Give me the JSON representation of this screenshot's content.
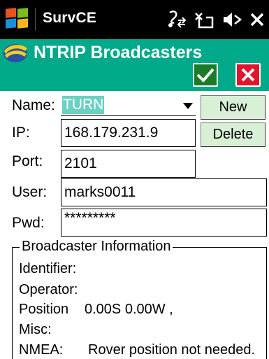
{
  "status_bar": {
    "app_name": "SurvCE",
    "icons": [
      "windows-start-icon",
      "connectivity-icon",
      "signal-off-icon",
      "volume-icon",
      "close-icon"
    ]
  },
  "title_bar": {
    "title": "NTRIP Broadcasters",
    "logo": "survce-logo-icon",
    "ok_icon": "checkmark-icon",
    "cancel_icon": "x-icon",
    "colors": {
      "background": "#00a98a",
      "ok": "#1b7c28",
      "cancel": "#e0142d"
    }
  },
  "form": {
    "name_label": "Name:",
    "name_value": "TURN",
    "ip_label": "IP:",
    "ip_value": "168.179.231.9",
    "port_label": "Port:",
    "port_value": "2101",
    "user_label": "User:",
    "user_value": "marks0011",
    "pwd_label": "Pwd:",
    "pwd_value": "*********",
    "new_button": "New",
    "delete_button": "Delete"
  },
  "info": {
    "legend": "Broadcaster Information",
    "identifier_label": "Identifier:",
    "identifier_value": "",
    "operator_label": "Operator:",
    "operator_value": "",
    "position_label": "Position",
    "position_value": "0.00S 0.00W ,",
    "misc_label": "Misc:",
    "misc_value": "",
    "nmea_label": "NMEA:",
    "nmea_value": "Rover position not needed."
  }
}
